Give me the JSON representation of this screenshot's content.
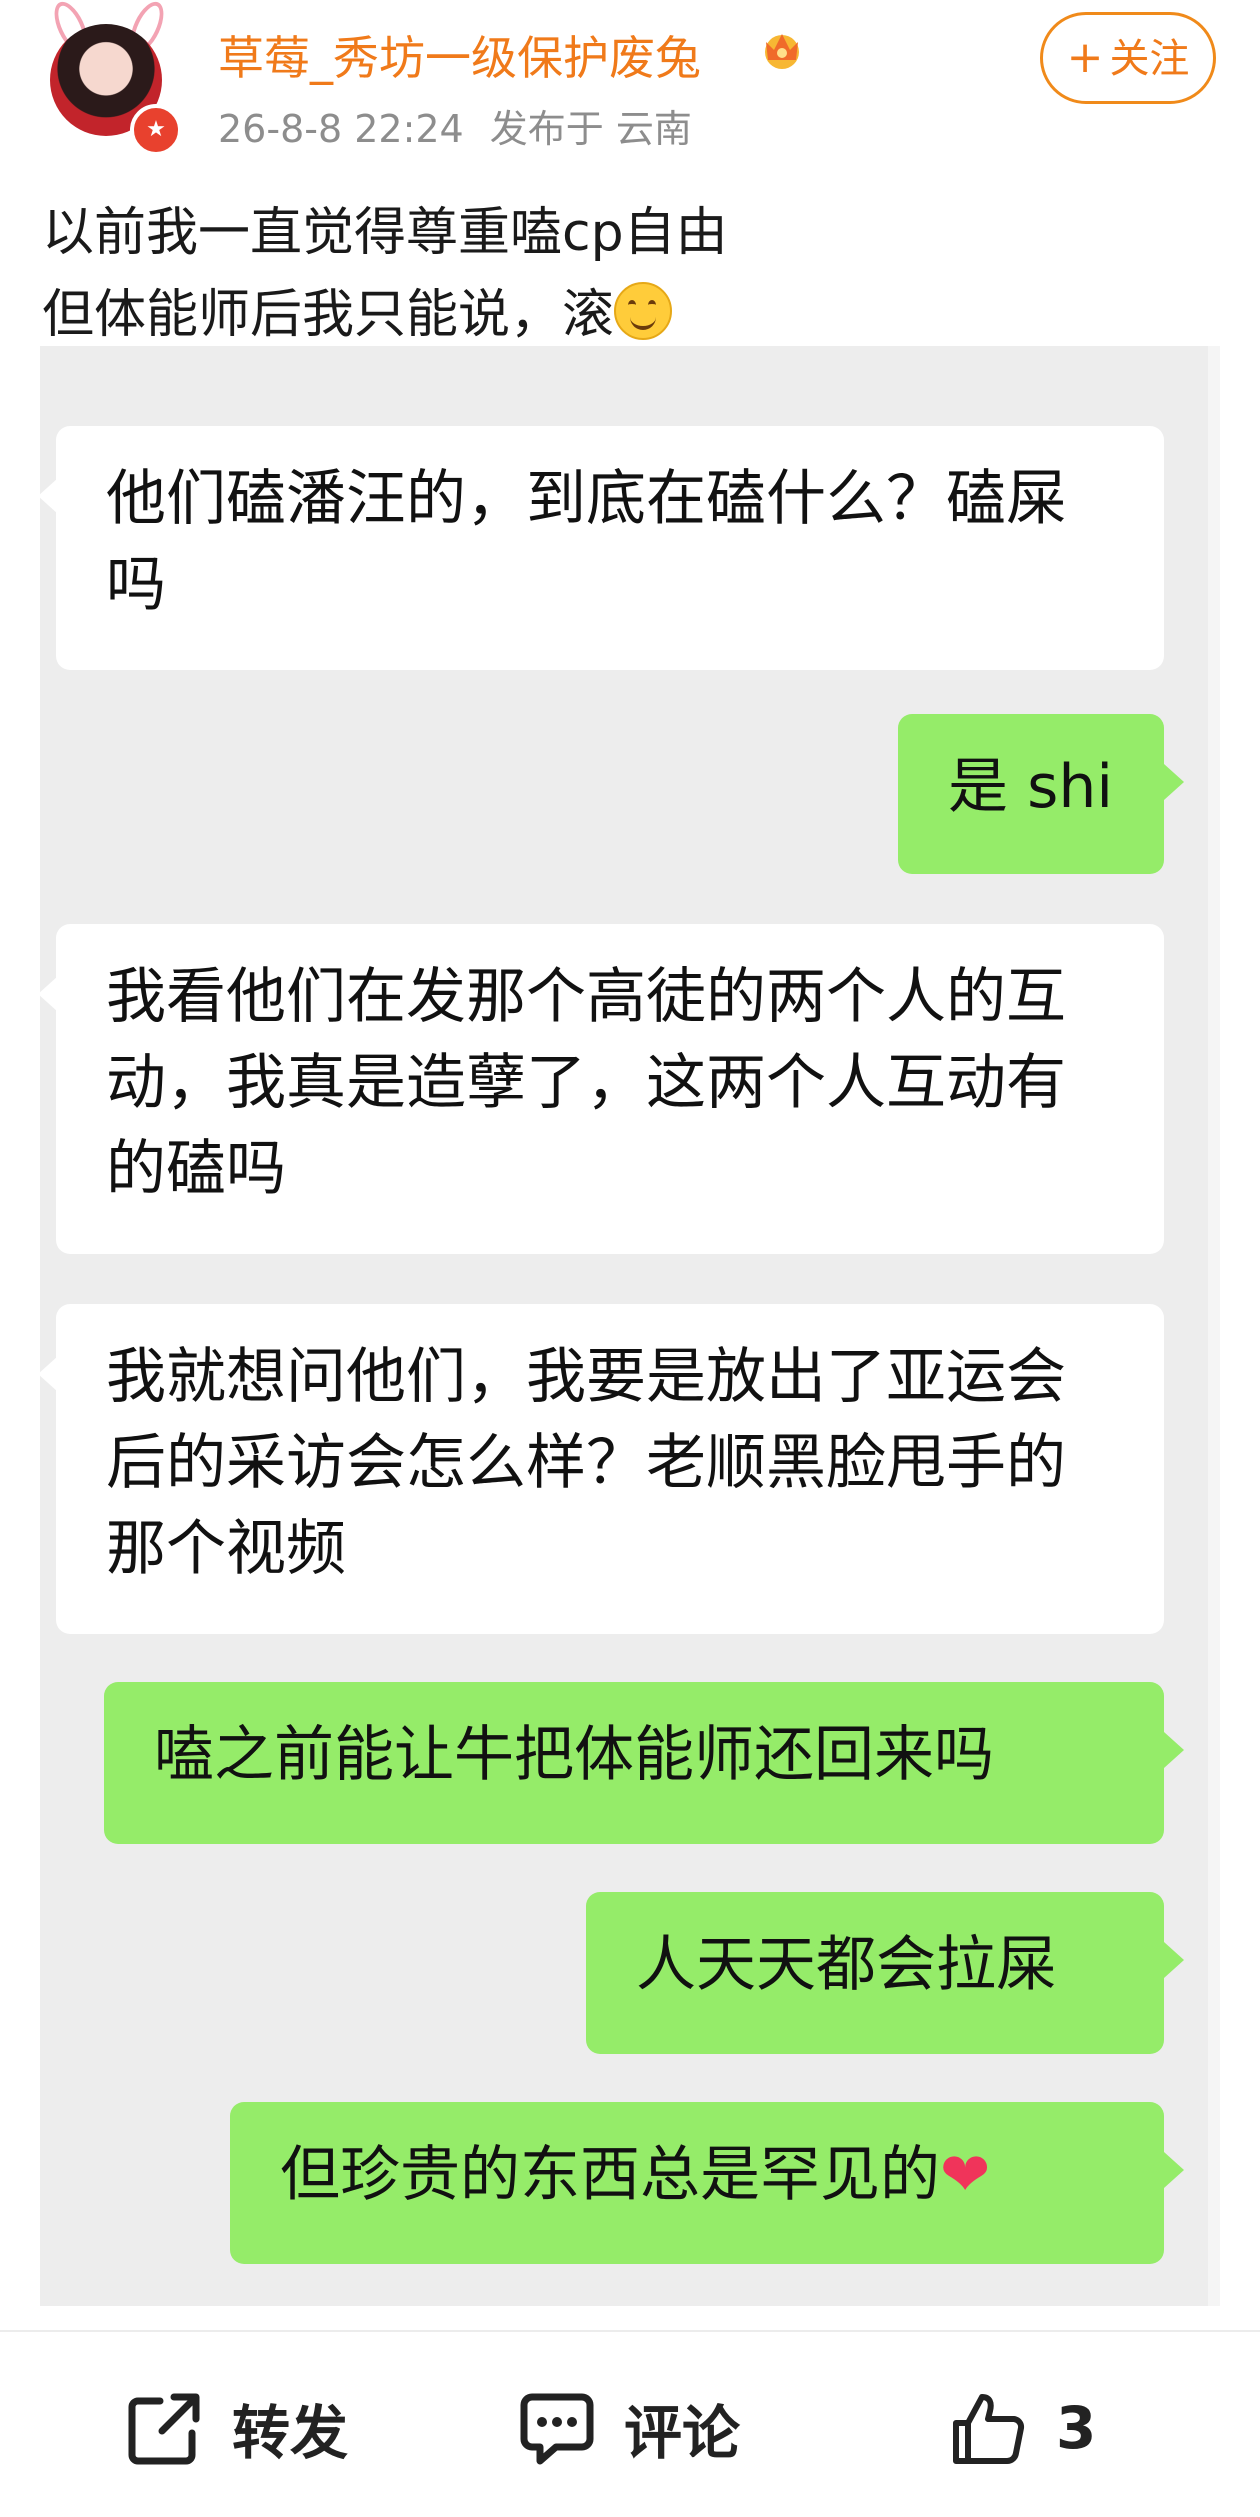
{
  "post": {
    "username": "草莓_秀坊一级保护废兔",
    "time": "26-8-8 22:24",
    "published_at": "发布于 云南",
    "follow_label": "关注",
    "text_line1": "以前我一直觉得尊重嗑cp自由",
    "text_line2": "但体能师后我只能说，滚"
  },
  "chat": {
    "messages": [
      {
        "side": "left",
        "text": "他们磕潘汪的，到底在磕什么？磕屎吗"
      },
      {
        "side": "right",
        "text": "是 shi"
      },
      {
        "side": "left",
        "text": "我看他们在发那个高徒的两个人的互动，我真是造孽了，这两个人互动有的磕吗"
      },
      {
        "side": "left",
        "text": "我就想问他们，我要是放出了亚运会后的采访会怎么样？老顺黑脸甩手的那个视频"
      },
      {
        "side": "right",
        "text": "嗑之前能让牛把体能师还回来吗"
      },
      {
        "side": "right",
        "text": "人天天都会拉屎"
      },
      {
        "side": "right",
        "text": "但珍贵的东西总是罕见的"
      }
    ]
  },
  "actions": {
    "share_label": "转发",
    "comment_label": "评论",
    "like_count": "3"
  },
  "icons": {
    "avatar_badge": "star-badge-icon",
    "vip": "crown-icon",
    "share": "share-icon",
    "comment": "comment-icon",
    "like": "thumbs-up-icon"
  },
  "colors": {
    "username": "#f07a1a",
    "bubble_right": "#95ec69",
    "bubble_left": "#ffffff",
    "chat_bg": "#ededed"
  }
}
